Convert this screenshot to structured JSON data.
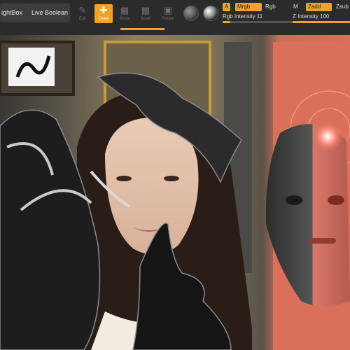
{
  "toolbar": {
    "lightbox_label": "ightBox",
    "live_boolean_label": "Live Boolean",
    "tools": [
      {
        "name": "edit",
        "label": "Edit",
        "active": false
      },
      {
        "name": "draw",
        "label": "Draw",
        "active": true
      },
      {
        "name": "move",
        "label": "Move",
        "active": false
      },
      {
        "name": "scale",
        "label": "Scale",
        "active": false
      },
      {
        "name": "rotate",
        "label": "Rotate",
        "active": false
      }
    ],
    "channels": {
      "a_label": "A",
      "mrgb_label": "Mrgb",
      "rgb_label": "Rgb",
      "m_label": "M",
      "zadd_label": "Zadd",
      "zsub_label": "Zsub"
    },
    "rgb_intensity": {
      "label": "Rgb Intensity 11",
      "value": 11,
      "max": 100
    },
    "z_intensity": {
      "label": "Z Intensity 100",
      "value": 100,
      "max": 100
    },
    "accent_color": "#f0a22a"
  },
  "canvas": {
    "background_color": "#d96f58",
    "description_icons": [
      "material-sphere-icon",
      "texture-sphere-icon"
    ]
  }
}
